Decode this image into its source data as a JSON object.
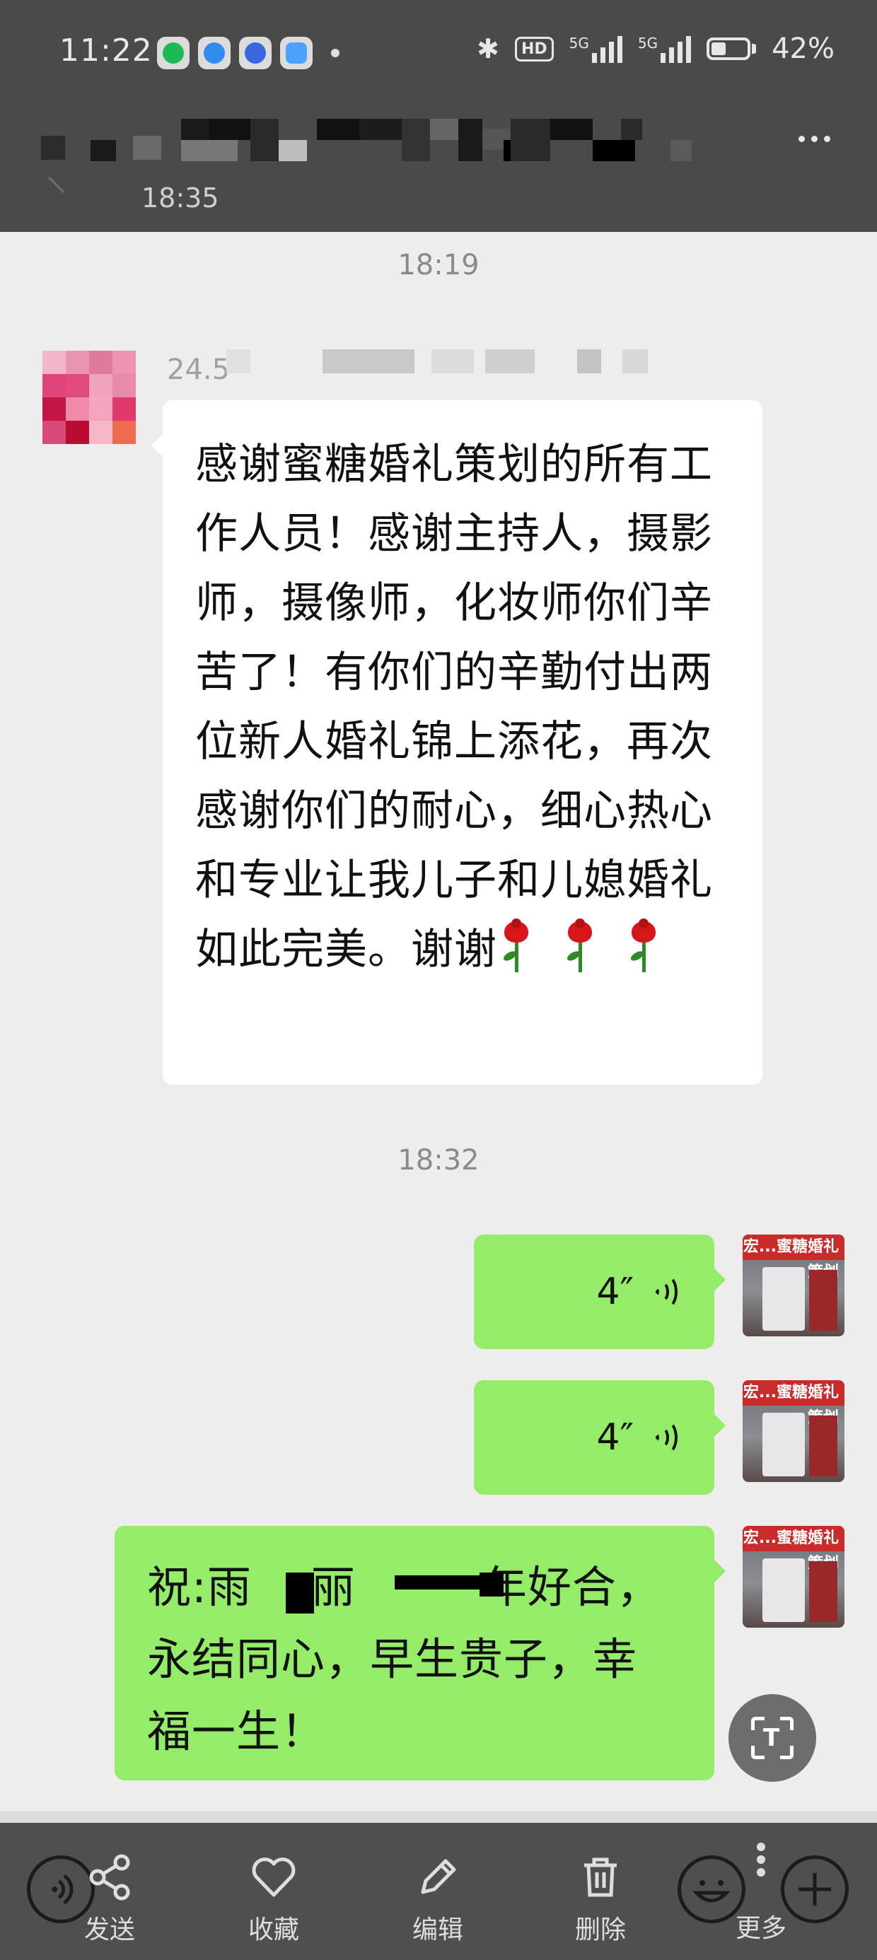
{
  "status_bar": {
    "time": "11:22",
    "network": "5G",
    "hd_badge": "HD",
    "battery_percent": "42%",
    "battery_level": 0.42,
    "app_icons": [
      "spotify-icon",
      "browser-icon",
      "baidu-icon",
      "notes-icon"
    ]
  },
  "chat_header": {
    "title_obscured": true,
    "time": "18:35"
  },
  "messages": {
    "divider_1": "18:19",
    "incoming": {
      "sender_partial": "24.5",
      "text": "感谢蜜糖婚礼策划的所有工作人员！感谢主持人，摄影师，摄像师，化妆师你们辛苦了！有你们的辛勤付出两位新人婚礼锦上添花，再次感谢你们的耐心，细心热心和专业让我儿子和儿媳婚礼如此完美。谢谢",
      "emoji": "rose-icon"
    },
    "divider_2": "18:32",
    "voice_1": {
      "duration": "4″"
    },
    "voice_2": {
      "duration": "4″"
    },
    "outgoing_text": {
      "line_1_prefix": "祝:雨",
      "line_1_mid": "丽",
      "line_1_suffix": "年好合，",
      "line_2": "永结同心，早生贵子，幸",
      "line_3": "福一生！"
    },
    "avatar_sign_text": "宏...蜜糖婚礼策划"
  },
  "toolbar": {
    "send_label": "发送",
    "favorite_label": "收藏",
    "edit_label": "编辑",
    "delete_label": "删除",
    "more_label": "更多"
  },
  "colors": {
    "bubble_green": "#95ec69",
    "bubble_white": "#ffffff",
    "chat_bg": "#ededed",
    "header_dim": "#4a4a4a"
  }
}
